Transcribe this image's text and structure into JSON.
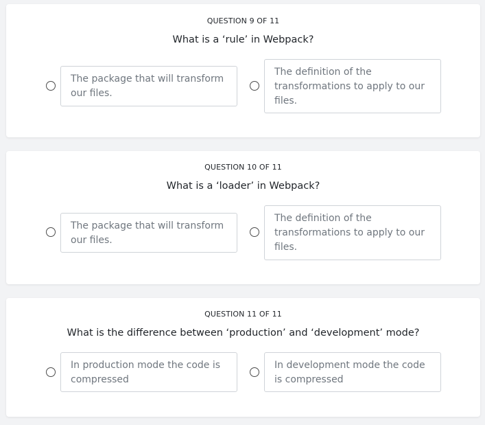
{
  "questions": [
    {
      "header": "QUESTION 9 OF 11",
      "title": "What is a ‘rule’ in Webpack?",
      "options": [
        "The package that will transform our files.",
        "The definition of the transformations to apply to our files."
      ]
    },
    {
      "header": "QUESTION 10 OF 11",
      "title": "What is a ‘loader’ in Webpack?",
      "options": [
        "The package that will transform our files.",
        "The definition of the transformations to apply to our files."
      ]
    },
    {
      "header": "QUESTION 11 OF 11",
      "title": "What is the difference between ‘production’ and ‘development’ mode?",
      "options": [
        "In production mode the code is compressed",
        "In development mode the code is compressed"
      ]
    }
  ],
  "colors": {
    "background": "#f2f3f5",
    "card": "#ffffff",
    "option_border": "#cfd3d8",
    "option_text": "#6f767e",
    "heading_text": "#1f2328"
  }
}
